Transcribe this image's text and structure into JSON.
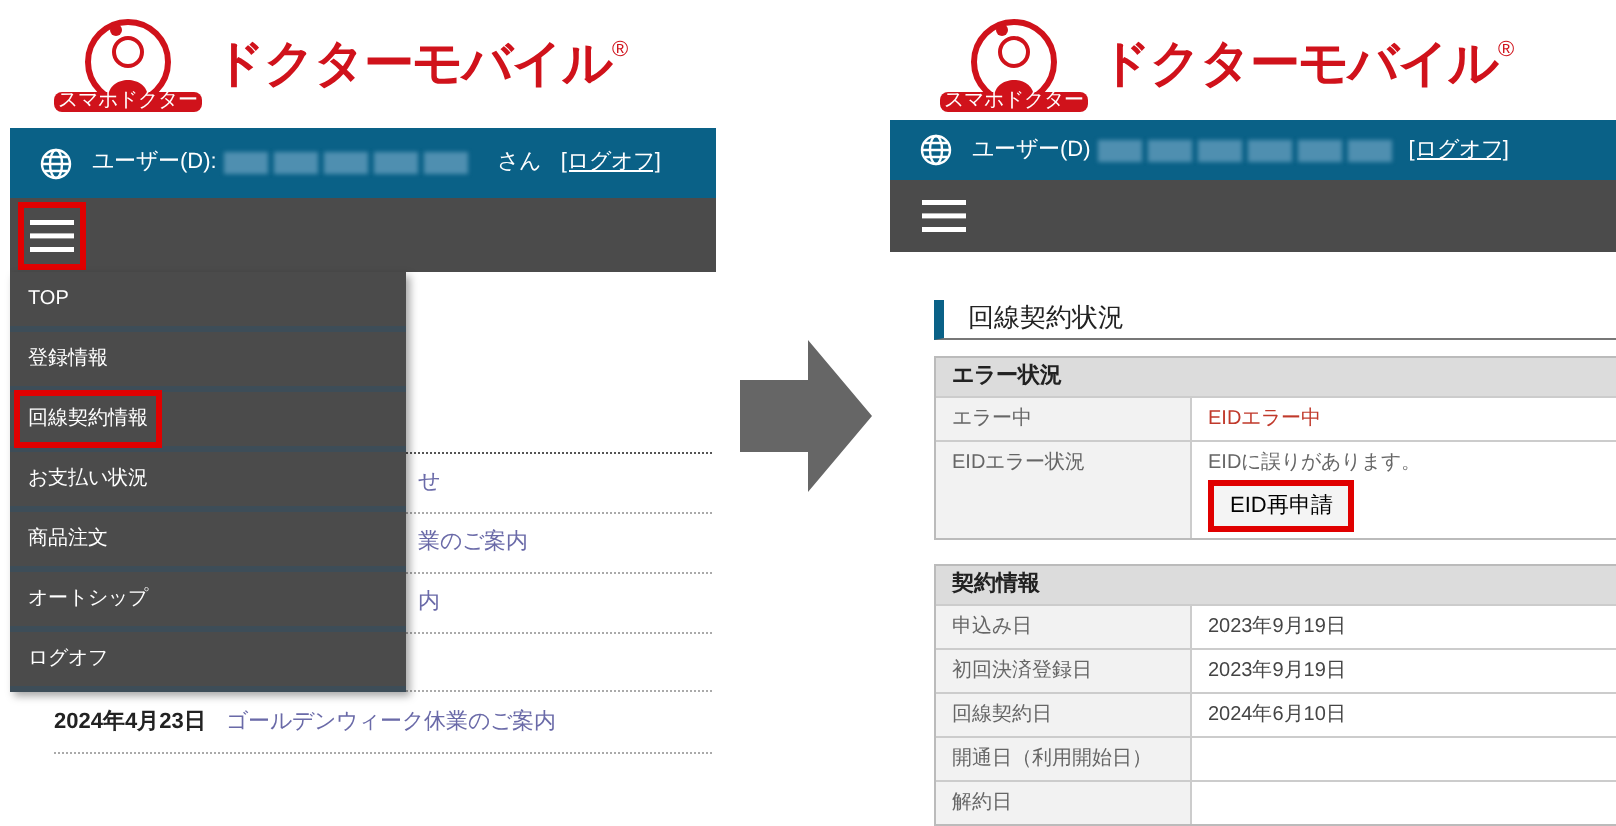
{
  "before": {
    "logo": {
      "badge": "スマホドクター",
      "wordmark": "ドクターモバイル",
      "mark": "®"
    },
    "user_bar": {
      "label": "ユーザー(D):",
      "suffix": "さん",
      "logoff": "[ログオフ]"
    },
    "menu_button": {
      "highlighted": true
    },
    "menu": [
      {
        "label": "TOP",
        "highlighted": false
      },
      {
        "label": "登録情報",
        "highlighted": false
      },
      {
        "label": "回線契約情報",
        "highlighted": true
      },
      {
        "label": "お支払い状況",
        "highlighted": false
      },
      {
        "label": "商品注文",
        "highlighted": false
      },
      {
        "label": "オートシップ",
        "highlighted": false
      },
      {
        "label": "ログオフ",
        "highlighted": false
      }
    ],
    "news": [
      {
        "title": "せ"
      },
      {
        "title": "業のご案内"
      },
      {
        "title": "内"
      },
      {
        "date": "2024年4月23日",
        "title": "ゴールデンウィーク休業のご案内"
      }
    ]
  },
  "after": {
    "logo": {
      "badge": "スマホドクター",
      "wordmark": "ドクターモバイル",
      "mark": "®"
    },
    "user_bar": {
      "label": "ユーザー(D)",
      "logoff": "[ログオフ]"
    },
    "section_title": "回線契約状況",
    "tables": [
      {
        "title": "エラー状況",
        "rows": [
          {
            "label": "エラー中",
            "value": "EIDエラー中",
            "kind": "error"
          },
          {
            "label": "EIDエラー状況",
            "value": "EIDに誤りがあります。",
            "kind": "action",
            "button": "EID再申請",
            "highlighted": true
          }
        ]
      },
      {
        "title": "契約情報",
        "rows": [
          {
            "label": "申込み日",
            "value": "2023年9月19日",
            "kind": "text"
          },
          {
            "label": "初回決済登録日",
            "value": "2023年9月19日",
            "kind": "text"
          },
          {
            "label": "回線契約日",
            "value": "2024年6月10日",
            "kind": "text"
          },
          {
            "label": "開通日（利用開始日）",
            "kind": "text"
          },
          {
            "label": "解約日",
            "kind": "text"
          }
        ]
      }
    ]
  }
}
